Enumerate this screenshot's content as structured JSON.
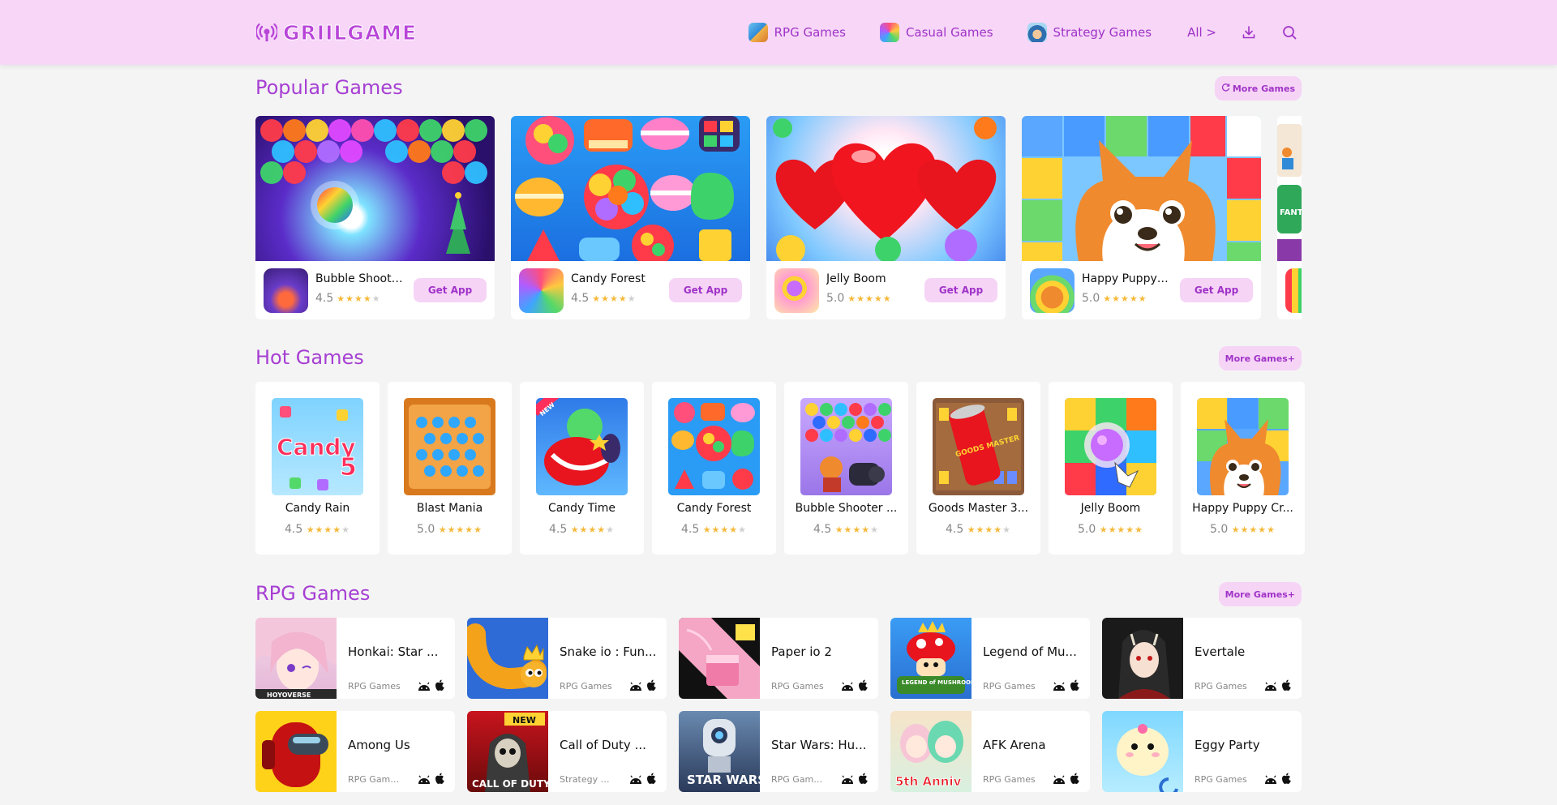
{
  "brand": {
    "logo_text": "GRIILGAME",
    "accent": "#a63fd3",
    "header_bg": "#f7d6f7"
  },
  "nav": {
    "items": [
      {
        "label": "RPG Games",
        "icon": "rpg-games-thumb"
      },
      {
        "label": "Casual Games",
        "icon": "casual-games-thumb"
      },
      {
        "label": "Strategy Games",
        "icon": "strategy-games-thumb"
      }
    ],
    "all_label": "All >",
    "download_icon": "download-icon",
    "search_icon": "search-icon"
  },
  "popular": {
    "title": "Popular Games",
    "more_label": "More Games",
    "cards": [
      {
        "name": "Bubble Shoote...",
        "rating": "4.5",
        "stars": 4.5,
        "button": "Get App"
      },
      {
        "name": "Candy Forest",
        "rating": "4.5",
        "stars": 4.5,
        "button": "Get App"
      },
      {
        "name": "Jelly Boom",
        "rating": "5.0",
        "stars": 5,
        "button": "Get App"
      },
      {
        "name": "Happy Puppy ...",
        "rating": "5.0",
        "stars": 5,
        "button": "Get App"
      }
    ]
  },
  "hot": {
    "title": "Hot Games",
    "more_label": "More Games+",
    "cards": [
      {
        "name": "Candy Rain",
        "rating": "4.5",
        "stars": 4.5
      },
      {
        "name": "Blast Mania",
        "rating": "5.0",
        "stars": 5
      },
      {
        "name": "Candy Time",
        "rating": "4.5",
        "stars": 4.5
      },
      {
        "name": "Candy Forest",
        "rating": "4.5",
        "stars": 4.5
      },
      {
        "name": "Bubble Shooter ...",
        "rating": "4.5",
        "stars": 4.5
      },
      {
        "name": "Goods Master 3...",
        "rating": "4.5",
        "stars": 4.5
      },
      {
        "name": "Jelly Boom",
        "rating": "5.0",
        "stars": 5
      },
      {
        "name": "Happy Puppy Cr...",
        "rating": "5.0",
        "stars": 5
      }
    ]
  },
  "rpg": {
    "title": "RPG Games",
    "more_label": "More Games+",
    "cards": [
      {
        "name": "Honkai: Star ...",
        "category": "RPG Games"
      },
      {
        "name": "Snake io : Fun...",
        "category": "RPG Games"
      },
      {
        "name": "Paper io 2",
        "category": "RPG Games"
      },
      {
        "name": "Legend of Mu...",
        "category": "RPG Games"
      },
      {
        "name": "Evertale",
        "category": "RPG Games"
      },
      {
        "name": "Among Us",
        "category": "RPG Games,..."
      },
      {
        "name": "Call of Duty ...",
        "category": "Strategy Ga..."
      },
      {
        "name": "Star Wars: Hu...",
        "category": "RPG Games,..."
      },
      {
        "name": "AFK Arena",
        "category": "RPG Games"
      },
      {
        "name": "Eggy Party",
        "category": "RPG Games"
      }
    ],
    "image_text": {
      "honkai": "HOYOVERSE",
      "legend": "LEGEND of MUSHROOM",
      "cod_badge": "NEW",
      "cod": "CALL OF DUTY",
      "starwars": "STAR WARS",
      "afk": "5th Anniv"
    }
  },
  "image_text": {
    "candy_rain": "Candy Rain",
    "candy_rain_num": "5",
    "candy_time_badge": "NEW",
    "goods_master": "GOODS MASTER",
    "fanta": "FANTA"
  }
}
